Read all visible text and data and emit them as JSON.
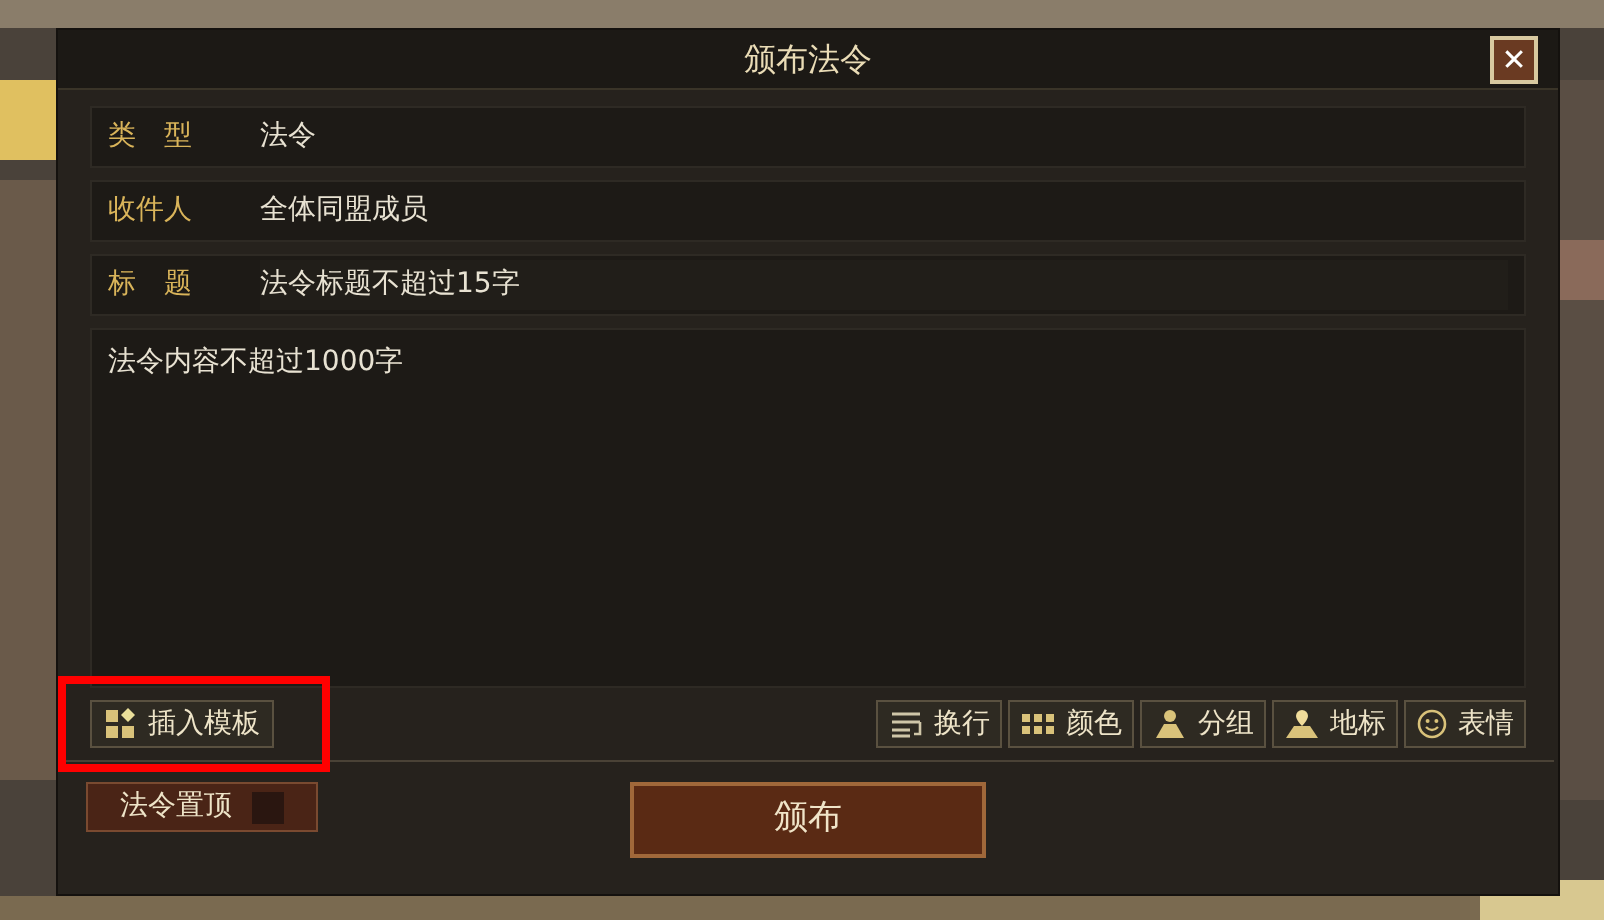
{
  "dialog": {
    "title": "颁布法令",
    "close": "✕"
  },
  "fields": [
    {
      "label": "类　型",
      "value": "法令",
      "kind": "value"
    },
    {
      "label": "收件人",
      "value": "全体同盟成员",
      "kind": "value"
    },
    {
      "label": "标　题",
      "placeholder": "法令标题不超过15字",
      "kind": "input"
    }
  ],
  "content": {
    "placeholder": "法令内容不超过1000字"
  },
  "template_button": {
    "label": "插入模板",
    "highlighted": true
  },
  "tools": [
    {
      "label": "换行",
      "kind": "wrap"
    },
    {
      "label": "颜色",
      "kind": "color"
    },
    {
      "label": "分组",
      "kind": "group"
    },
    {
      "label": "地标",
      "kind": "landmark"
    },
    {
      "label": "表情",
      "kind": "emoji"
    }
  ],
  "pin": {
    "label": "法令置顶",
    "checked": false
  },
  "submit": {
    "label": "颁布"
  }
}
